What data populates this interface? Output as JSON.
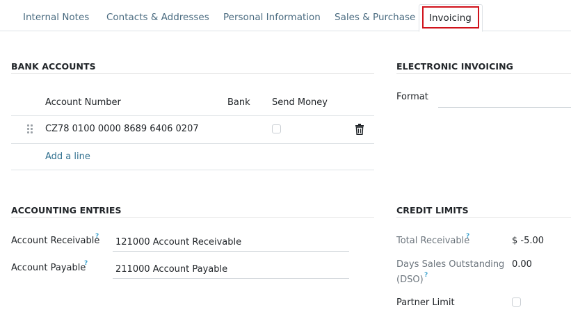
{
  "tabs": [
    {
      "label": "Internal Notes"
    },
    {
      "label": "Contacts & Addresses"
    },
    {
      "label": "Personal Information"
    },
    {
      "label": "Sales & Purchase"
    },
    {
      "label": "Invoicing"
    }
  ],
  "bank_accounts": {
    "title": "BANK ACCOUNTS",
    "columns": {
      "account_number": "Account Number",
      "bank": "Bank",
      "send_money": "Send Money"
    },
    "rows": [
      {
        "account_number": "CZ78 0100 0000 8689 6406 0207",
        "bank": "",
        "send_money": false
      }
    ],
    "add_line": "Add a line"
  },
  "electronic_invoicing": {
    "title": "ELECTRONIC INVOICING",
    "format_label": "Format",
    "format_value": ""
  },
  "accounting_entries": {
    "title": "ACCOUNTING ENTRIES",
    "receivable_label": "Account Receivable",
    "receivable_value": "121000 Account Receivable",
    "payable_label": "Account Payable",
    "payable_value": "211000 Account Payable",
    "help_mark": "?"
  },
  "credit_limits": {
    "title": "CREDIT LIMITS",
    "total_receivable_label": "Total Receivable",
    "total_receivable_value": "$ -5.00",
    "dso_label_line1": "Days Sales Outstanding",
    "dso_label_line2": "(DSO)",
    "dso_value": "0.00",
    "partner_limit_label": "Partner Limit",
    "partner_limit_checked": false,
    "help_mark": "?"
  },
  "colors": {
    "active_tab_highlight": "#d0121b",
    "link": "#31708f",
    "help": "#3fa3cf"
  }
}
